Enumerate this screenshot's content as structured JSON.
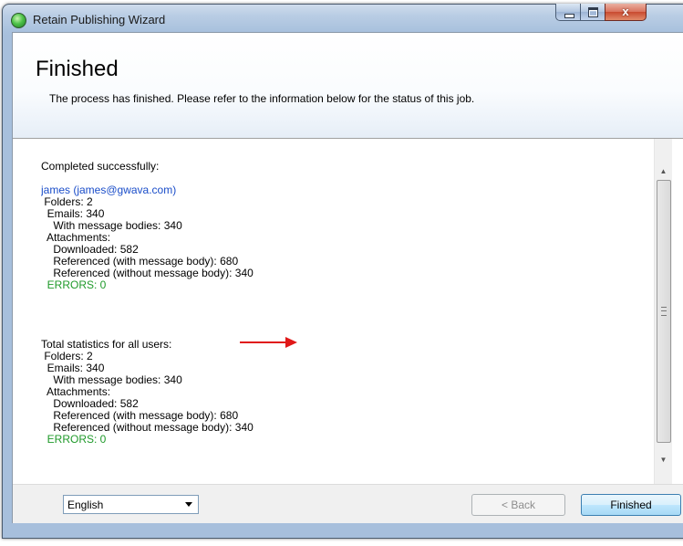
{
  "window": {
    "title": "Retain Publishing Wizard",
    "close_glyph": "x"
  },
  "header": {
    "title": "Finished",
    "description": "The process has finished. Please refer to the information below for the status of this job."
  },
  "report": {
    "lines": [
      {
        "text": "Completed successfully:",
        "style": "normal"
      },
      {
        "text": "",
        "style": "spacer"
      },
      {
        "text": "james (james@gwava.com)",
        "style": "blue"
      },
      {
        "text": " Folders: 2",
        "style": "normal"
      },
      {
        "text": "  Emails: 340",
        "style": "normal"
      },
      {
        "text": "    With message bodies: 340",
        "style": "normal"
      },
      {
        "text": "  Attachments:",
        "style": "normal"
      },
      {
        "text": "    Downloaded: 582",
        "style": "normal"
      },
      {
        "text": "    Referenced (with message body): 680",
        "style": "normal"
      },
      {
        "text": "    Referenced (without message body): 340",
        "style": "normal"
      },
      {
        "text": "  ERRORS: 0",
        "style": "green"
      },
      {
        "text": "",
        "style": "spacer"
      },
      {
        "text": "",
        "style": "spacer"
      },
      {
        "text": "",
        "style": "spacer"
      },
      {
        "text": "",
        "style": "spacer"
      },
      {
        "text": "Total statistics for all users:",
        "style": "normal"
      },
      {
        "text": " Folders: 2",
        "style": "normal"
      },
      {
        "text": "  Emails: 340",
        "style": "normal"
      },
      {
        "text": "    With message bodies: 340",
        "style": "normal"
      },
      {
        "text": "  Attachments:",
        "style": "normal"
      },
      {
        "text": "    Downloaded: 582",
        "style": "normal"
      },
      {
        "text": "    Referenced (with message body): 680",
        "style": "normal"
      },
      {
        "text": "    Referenced (without message body): 340",
        "style": "normal"
      },
      {
        "text": "  ERRORS: 0",
        "style": "green"
      }
    ]
  },
  "scrollbar": {
    "up_glyph": "▲",
    "down_glyph": "▼"
  },
  "footer": {
    "language": "English",
    "back_label": "< Back",
    "finish_label": "Finished"
  },
  "colors": {
    "link_blue": "#1a4dc9",
    "error_green": "#1f9a2a",
    "arrow_red": "#e01818"
  }
}
